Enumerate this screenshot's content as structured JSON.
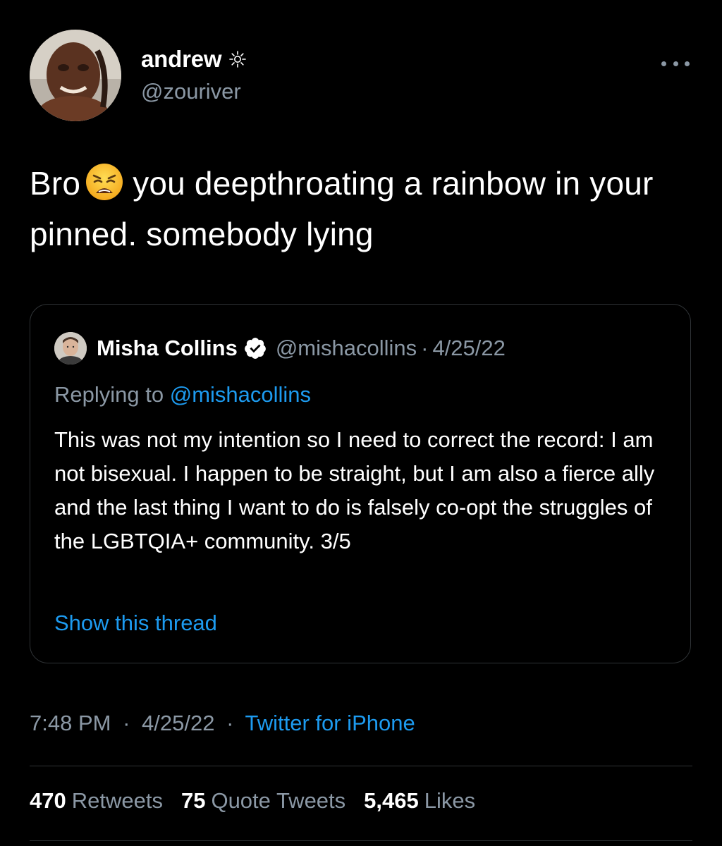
{
  "author": {
    "display_name": "andrew",
    "handle": "@zouriver",
    "name_icon": "sun-icon",
    "avatar": "avatar"
  },
  "tweet": {
    "text_before_emoji": "Bro",
    "emoji": "weary-face-emoji",
    "text_after_emoji": "you deepthroating a rainbow in your pinned. somebody lying"
  },
  "quoted_tweet": {
    "display_name": "Misha Collins",
    "verified_icon": "verified-badge-icon",
    "handle": "@mishacollins",
    "separator": "·",
    "date": "4/25/22",
    "replying_label": "Replying to",
    "replying_mention": "@mishacollins",
    "text": "This was not my intention so I need to correct the record: I am not bisexual. I happen to be straight, but I am also a fierce ally and the last thing I want to do is falsely co-opt the struggles of the LGBTQIA+ community. 3/5",
    "show_thread_label": "Show this thread"
  },
  "meta": {
    "time": "7:48 PM",
    "separator": "·",
    "date": "4/25/22",
    "source": "Twitter for iPhone"
  },
  "stats": {
    "retweets_count": "470",
    "retweets_label": "Retweets",
    "quotes_count": "75",
    "quotes_label": "Quote Tweets",
    "likes_count": "5,465",
    "likes_label": "Likes"
  },
  "colors": {
    "background": "#000000",
    "text_primary": "#ffffff",
    "text_secondary": "#8b98a5",
    "accent": "#1d9bf0",
    "border": "#2f3336"
  }
}
